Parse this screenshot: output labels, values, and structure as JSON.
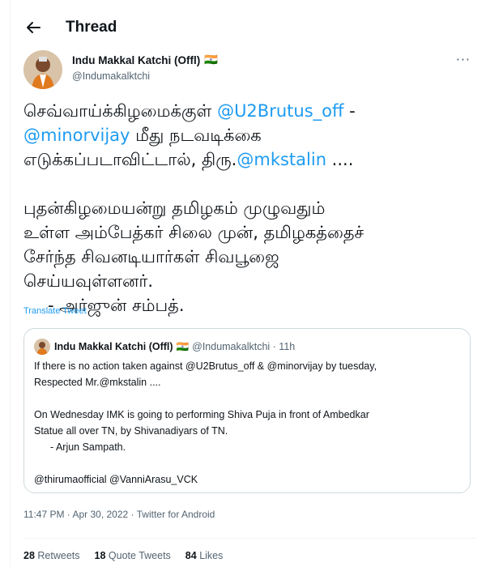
{
  "header": {
    "title": "Thread"
  },
  "author": {
    "name": "Indu Makkal Katchi (Offl)",
    "flag": "🇮🇳",
    "handle": "@Indumakalktchi",
    "more": "···"
  },
  "tweet": {
    "line1_text": "செவ்வாய்க்கிழமைக்குள் ",
    "line1_mention": "@U2Brutus_off",
    "line1_suffix": " -",
    "line2_mention": "@minorvijay",
    "line2_text": " மீது நடவடிக்கை",
    "line3_text": "எடுக்கப்படாவிட்டால், திரு.",
    "line3_mention": "@mkstalin",
    "line3_suffix": " ....",
    "line4": "புதன்கிழமையன்று தமிழகம் முழுவதும்",
    "line5": "உள்ள அம்பேத்கர் சிலை முன், தமிழகத்தைச்",
    "line6": "சேர்ந்த சிவனடியார்கள் சிவபூஜை",
    "line7": "செய்யவுள்ளனர்.",
    "line8": "- அர்ஜுன் சம்பத்.",
    "translate": "Translate Tweet"
  },
  "quote": {
    "name": "Indu Makkal Katchi (Offl)",
    "flag": "🇮🇳",
    "meta": "@Indumakalktchi · 11h",
    "line1": "If there is no action taken against @U2Brutus_off & @minorvijay  by tuesday,",
    "line2": "Respected Mr.@mkstalin ....",
    "line3": "On Wednesday IMK is going to performing Shiva Puja in front of Ambedkar",
    "line4": "Statue all over TN, by Shivanadiyars of TN.",
    "line5": "- Arjun Sampath.",
    "line6": "@thirumaofficial @VanniArasu_VCK"
  },
  "meta": {
    "line": "11:47 PM · Apr 30, 2022 · Twitter for Android"
  },
  "stats": {
    "retweets_count": "28",
    "retweets_label": "Retweets",
    "quotes_count": "18",
    "quotes_label": "Quote Tweets",
    "likes_count": "84",
    "likes_label": "Likes"
  },
  "colors": {
    "accent": "#1d9bf0",
    "muted": "#536471",
    "border": "#cfd9de"
  }
}
